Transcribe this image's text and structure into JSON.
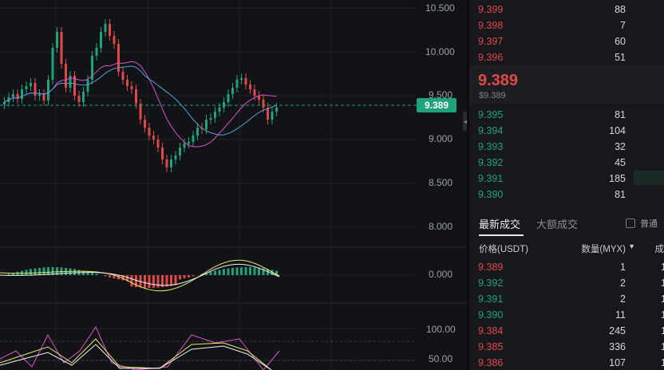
{
  "chart": {
    "price_axis": [
      "10.500",
      "10.000",
      "9.500",
      "9.000",
      "8.500",
      "8.000",
      "0.000",
      "100.00",
      "50.00"
    ],
    "current_price_tag": "9.389",
    "colors": {
      "up": "#1fa37d",
      "down": "#e04848",
      "ma1": "#e052c8",
      "ma2": "#4aa3df",
      "kdj_k": "#e8e86a",
      "kdj_d": "#f0f0f0"
    }
  },
  "orderbook": {
    "asks": [
      {
        "price": "9.399",
        "qty": "88"
      },
      {
        "price": "9.398",
        "qty": "7"
      },
      {
        "price": "9.397",
        "qty": "60"
      },
      {
        "price": "9.396",
        "qty": "51"
      }
    ],
    "last_price": "9.389",
    "last_price_usd": "$9.389",
    "bids": [
      {
        "price": "9.395",
        "qty": "81"
      },
      {
        "price": "9.394",
        "qty": "104"
      },
      {
        "price": "9.393",
        "qty": "32"
      },
      {
        "price": "9.392",
        "qty": "45"
      },
      {
        "price": "9.391",
        "qty": "185"
      },
      {
        "price": "9.390",
        "qty": "81"
      }
    ]
  },
  "trades": {
    "tab_latest": "最新成交",
    "tab_large": "大额成交",
    "normal_label": "普通",
    "header_price": "价格(USDT)",
    "header_qty": "数量(MYX)",
    "header_time": "成",
    "rows": [
      {
        "price": "9.389",
        "qty": "1",
        "side": "sell",
        "time": "1"
      },
      {
        "price": "9.392",
        "qty": "2",
        "side": "buy",
        "time": "1"
      },
      {
        "price": "9.391",
        "qty": "2",
        "side": "buy",
        "time": "1"
      },
      {
        "price": "9.390",
        "qty": "11",
        "side": "buy",
        "time": "1"
      },
      {
        "price": "9.384",
        "qty": "245",
        "side": "sell",
        "time": "1"
      },
      {
        "price": "9.385",
        "qty": "336",
        "side": "sell",
        "time": "1"
      },
      {
        "price": "9.386",
        "qty": "107",
        "side": "sell",
        "time": "1"
      }
    ]
  }
}
